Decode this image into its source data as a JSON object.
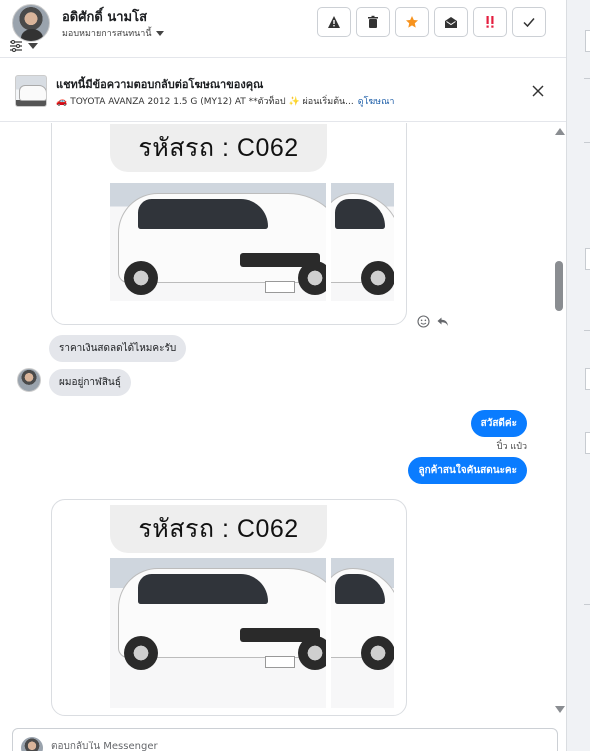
{
  "header": {
    "user_name": "อดิศักดิ์ นามโส",
    "assign_label": "มอบหมายการสนทนานี้",
    "toolbar": [
      {
        "icon": "warning-icon"
      },
      {
        "icon": "trash-icon"
      },
      {
        "icon": "star-icon",
        "color": "#f7931e"
      },
      {
        "icon": "envelope-open-icon"
      },
      {
        "icon": "spam-icon",
        "color": "#e41e3f"
      },
      {
        "icon": "check-icon"
      }
    ]
  },
  "banner": {
    "title": "แชทนี้มีข้อความตอบกลับต่อโฆษณาของคุณ",
    "ad_text": "TOYOTA AVANZA 2012 1.5 G (MY12) AT **ตัวท็อป ✨ ผ่อนเริ่มต้น...",
    "ad_link": "ดูโฆษณา"
  },
  "chat": {
    "image_cards": [
      {
        "code": "รหัสรถ : C062"
      },
      {
        "code": "รหัสรถ : C062"
      }
    ],
    "incoming": [
      {
        "text": "ราคาเงินสดลดได้ไหมคะรับ"
      },
      {
        "text": "ผมอยู่กาฬสินธุ์"
      }
    ],
    "outgoing": [
      {
        "text": "สวัสดีค่ะ"
      },
      {
        "text": "ลูกค้าสนใจคันสดนะคะ"
      }
    ],
    "seen_by": "ปิ๋ว แป๋ว"
  },
  "composer": {
    "placeholder": "ตอบกลับใน Messenger"
  },
  "colors": {
    "outgoing_bubble": "#0a7cff",
    "incoming_bubble": "#e4e6eb",
    "link": "#1d5ea8"
  }
}
